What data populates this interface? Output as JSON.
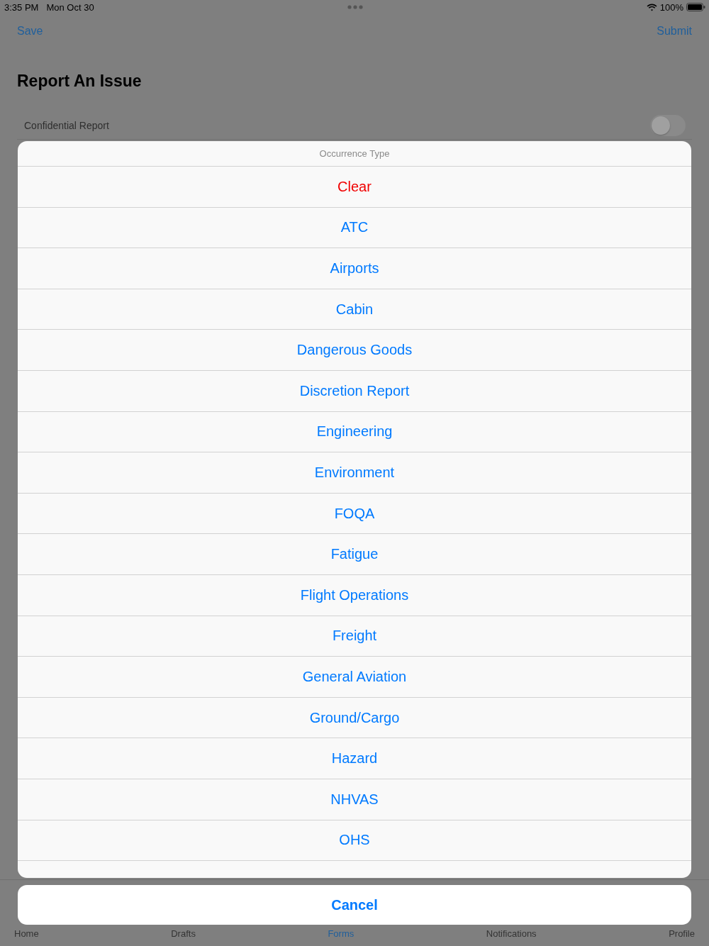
{
  "status_bar": {
    "time": "3:35 PM",
    "date": "Mon Oct 30",
    "battery": "100%"
  },
  "nav_bar": {
    "left_button": "Save",
    "right_button": "Submit"
  },
  "title": "Report An Issue",
  "form": {
    "rows": [
      {
        "label": "Confidential Report",
        "kind": "toggle",
        "on": false
      }
    ]
  },
  "action_sheet": {
    "title": "Occurrence Type",
    "options": [
      {
        "label": "Clear",
        "kind": "destructive"
      },
      {
        "label": "ATC",
        "kind": "default"
      },
      {
        "label": "Airports",
        "kind": "default"
      },
      {
        "label": "Cabin",
        "kind": "default"
      },
      {
        "label": "Dangerous Goods",
        "kind": "default"
      },
      {
        "label": "Discretion Report",
        "kind": "default"
      },
      {
        "label": "Engineering",
        "kind": "default"
      },
      {
        "label": "Environment",
        "kind": "default"
      },
      {
        "label": "FOQA",
        "kind": "default"
      },
      {
        "label": "Fatigue",
        "kind": "default"
      },
      {
        "label": "Flight Operations",
        "kind": "default"
      },
      {
        "label": "Freight",
        "kind": "default"
      },
      {
        "label": "General Aviation",
        "kind": "default"
      },
      {
        "label": "Ground/Cargo",
        "kind": "default"
      },
      {
        "label": "Hazard",
        "kind": "default"
      },
      {
        "label": "NHVAS",
        "kind": "default"
      },
      {
        "label": "OHS",
        "kind": "default"
      }
    ],
    "cancel": "Cancel"
  },
  "tab_bar": {
    "items": [
      {
        "label": "Home",
        "selected": false
      },
      {
        "label": "Drafts",
        "selected": false
      },
      {
        "label": "Forms",
        "selected": true
      },
      {
        "label": "Notifications",
        "selected": false
      },
      {
        "label": "Profile",
        "selected": false
      }
    ]
  }
}
